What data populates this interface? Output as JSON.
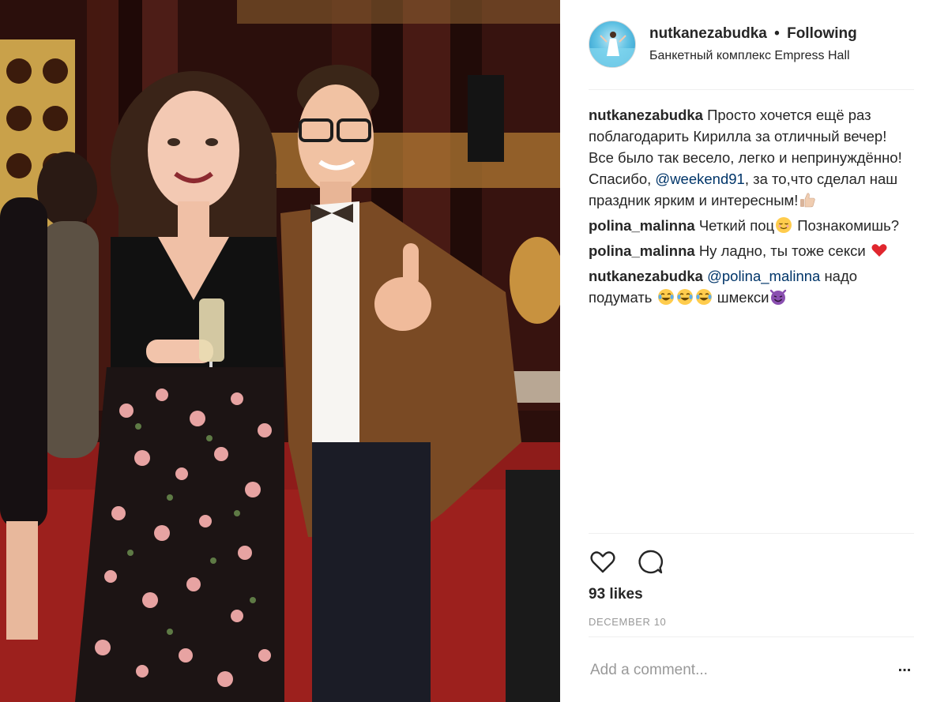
{
  "post": {
    "author": "nutkanezabudka",
    "separator": "•",
    "follow_label": "Following",
    "location": "Банкетный комплекс Empress Hall"
  },
  "photo": {
    "description_icon": "photo-image"
  },
  "comments": [
    {
      "user": "nutkanezabudka",
      "text_1": "Просто хочется ещё раз поблагодарить Кирилла за отличный вечер! Все было так весело, легко и непринуждённо! Спасибо, ",
      "mention": "@weekend91",
      "text_2": ", за то,что сделал наш праздник ярким и интересным!",
      "emoji": [
        "thumbs-up-light-skin"
      ]
    },
    {
      "user": "polina_malinna",
      "text_1": "Четкий поц",
      "text_2": " Познакомишь?",
      "emoji": [
        "relieved-face"
      ]
    },
    {
      "user": "polina_malinna",
      "text_1": "Ну ладно, ты тоже секси ",
      "emoji": [
        "red-heart"
      ]
    },
    {
      "user": "nutkanezabudka",
      "mention": "@polina_malinna",
      "text_1": " надо подумать ",
      "text_2": " шмекси",
      "emoji": [
        "tears-of-joy",
        "tears-of-joy",
        "tears-of-joy",
        "smiling-imp"
      ]
    }
  ],
  "actions": {
    "like_icon": "heart-icon",
    "comment_icon": "comment-bubble-icon",
    "likes_text": "93 likes",
    "date": "DECEMBER 10"
  },
  "add_comment": {
    "placeholder": "Add a comment...",
    "more_label": "..."
  },
  "colors": {
    "text": "#262626",
    "mention": "#003569",
    "muted": "#999999",
    "divider": "#efefef"
  }
}
